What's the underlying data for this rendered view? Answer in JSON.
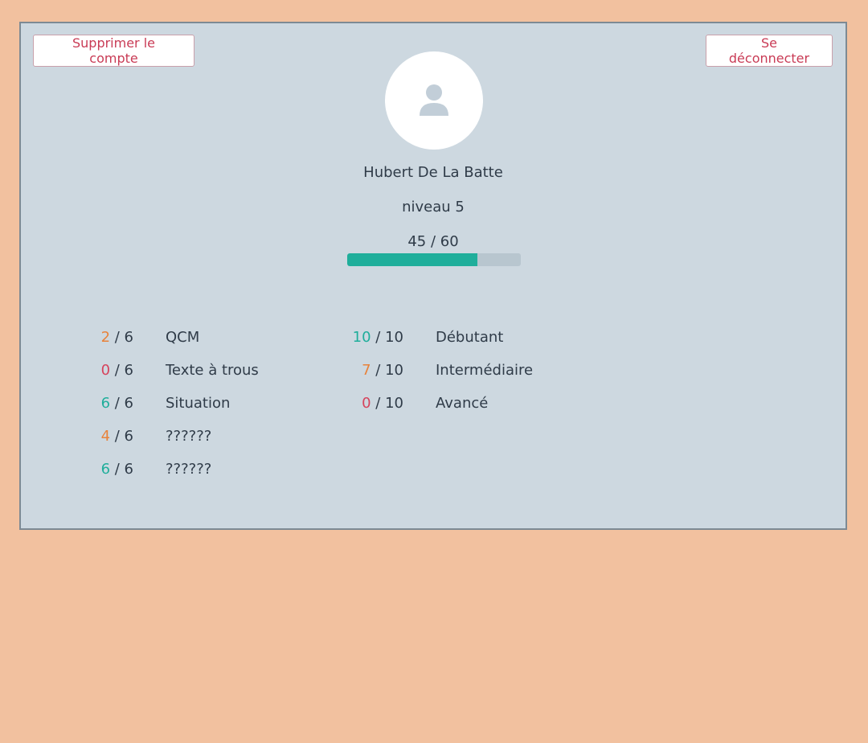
{
  "header": {
    "delete_account_label": "Supprimer le compte",
    "logout_label": "Se déconnecter"
  },
  "profile": {
    "avatar_icon": "user-icon",
    "name": "Hubert De La Batte",
    "level": "niveau 5",
    "xp_text": "45 / 60",
    "xp_current": 45,
    "xp_max": 60
  },
  "categories": [
    {
      "score": "2",
      "total": "/ 6",
      "label": "QCM",
      "status": "orange"
    },
    {
      "score": "0",
      "total": "/ 6",
      "label": "Texte à trous",
      "status": "red"
    },
    {
      "score": "6",
      "total": "/ 6",
      "label": "Situation",
      "status": "teal"
    },
    {
      "score": "4",
      "total": "/ 6",
      "label": "??????",
      "status": "orange"
    },
    {
      "score": "6",
      "total": "/ 6",
      "label": "??????",
      "status": "teal"
    }
  ],
  "levels": [
    {
      "score": "10",
      "total": "/ 10",
      "label": "Débutant",
      "status": "teal"
    },
    {
      "score": "7",
      "total": "/ 10",
      "label": "Intermédiaire",
      "status": "orange"
    },
    {
      "score": "0",
      "total": "/ 10",
      "label": "Avancé",
      "status": "red"
    }
  ],
  "colors": {
    "background": "#f2c19f",
    "panel": "#cdd8e0",
    "accent_red": "#c93b55",
    "progress_fill": "#1fae9b",
    "progress_track": "#b8c6cf",
    "status_orange": "#e8823a",
    "status_red": "#d6435c",
    "status_teal": "#1fae9b"
  }
}
